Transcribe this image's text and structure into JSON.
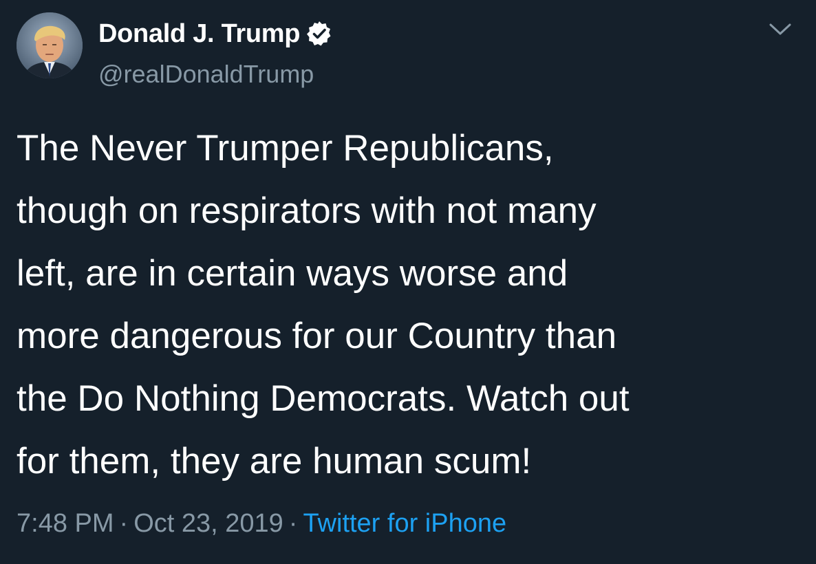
{
  "author": {
    "display_name": "Donald J. Trump",
    "handle": "@realDonaldTrump",
    "verified": true
  },
  "tweet": {
    "text_lines": [
      "The Never Trumper Republicans,",
      "though on respirators with not many",
      "left, are in certain ways worse and",
      "more dangerous for our Country than",
      "the Do Nothing Democrats. Watch out",
      "for them, they are human scum!"
    ],
    "time": "7:48 PM",
    "separator": "·",
    "date": "Oct 23, 2019",
    "source": "Twitter for iPhone"
  },
  "icons": {
    "verified": "verified-badge-icon",
    "menu": "chevron-down-icon"
  },
  "colors": {
    "background": "#15202b",
    "primary_text": "#ffffff",
    "secondary_text": "#8899a6",
    "link": "#1da1f2"
  }
}
